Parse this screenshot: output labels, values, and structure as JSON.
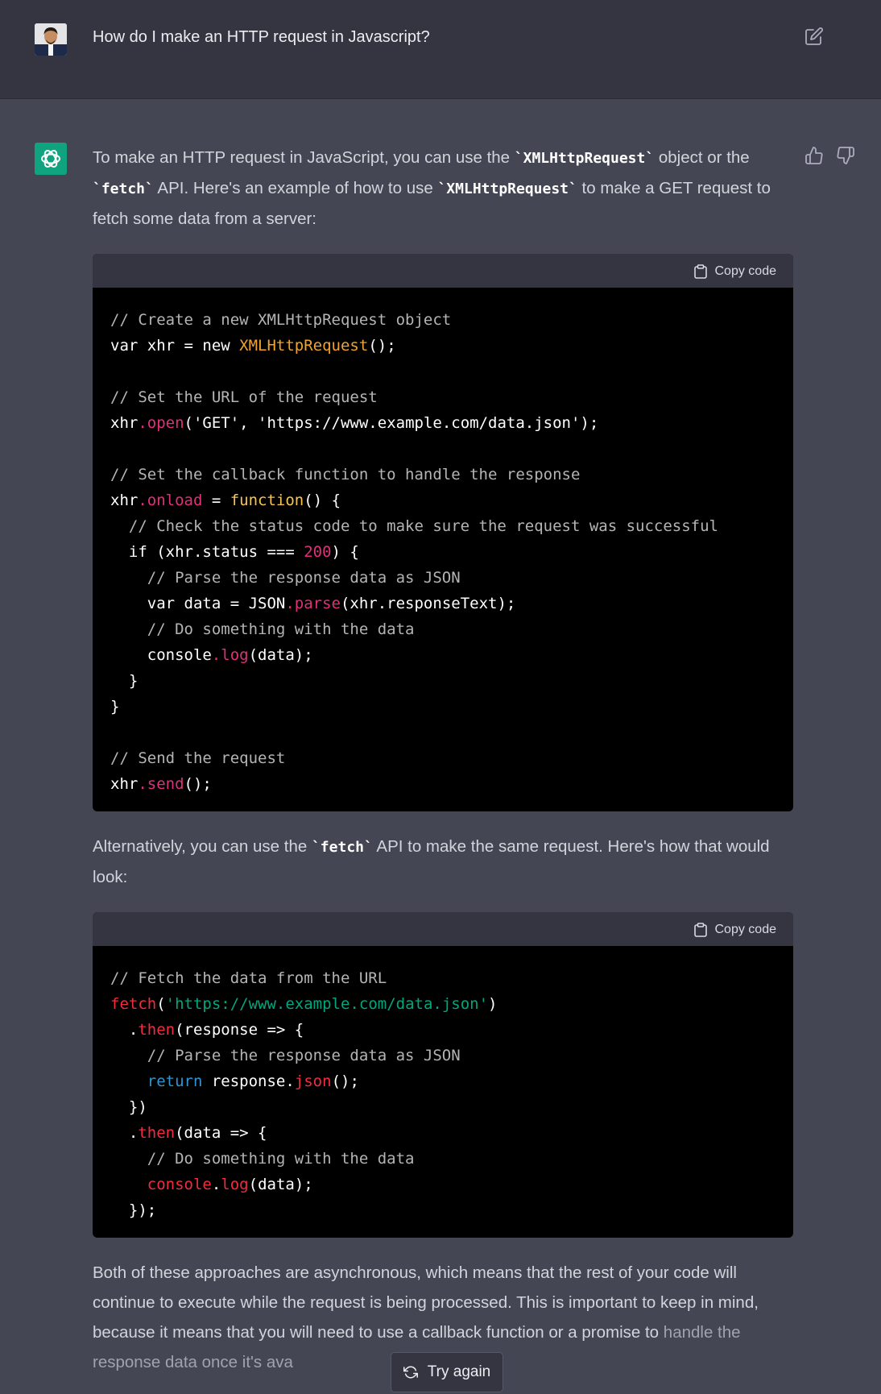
{
  "user_message": {
    "text": "How do I make an HTTP request in Javascript?"
  },
  "assistant": {
    "intro": {
      "p1": "To make an HTTP request in JavaScript, you can use the ",
      "c1": "`XMLHttpRequest`",
      "p2": " object or the ",
      "c2": "`fetch`",
      "p3": " API. Here's an example of how to use ",
      "c3": "`XMLHttpRequest`",
      "p4": " to make a GET request to fetch some data from a server:"
    },
    "copy_label": "Copy code",
    "code1": [
      "// Create a new XMLHttpRequest object",
      "var xhr = new ",
      "XMLHttpRequest",
      "();",
      "// Set the URL of the request",
      "xhr",
      ".open",
      "('GET', 'https://www.example.com/data.json');",
      "// Set the callback function to handle the response",
      "xhr",
      ".onload",
      " = ",
      "function",
      "() {",
      "  // Check the status code to make sure the request was successful",
      "  if (xhr.status === ",
      "200",
      ") {",
      "    // Parse the response data as JSON",
      "    var data = JSON",
      ".parse",
      "(xhr.responseText);",
      "    // Do something with the data",
      "    console",
      ".log",
      "(data);",
      "  }",
      "}",
      "// Send the request",
      "xhr",
      ".send",
      "();"
    ],
    "middle": {
      "p1": "Alternatively, you can use the ",
      "c1": "`fetch`",
      "p2": " API to make the same request. Here's how that would look:"
    },
    "code2": [
      "// Fetch the data from the URL",
      "fetch",
      "(",
      "'https://www.example.com/data.json'",
      ")",
      "  .",
      "then",
      "(response => {",
      "    // Parse the response data as JSON",
      "    ",
      "return",
      " response.",
      "json",
      "();",
      "  })",
      "  .",
      "then",
      "(data => {",
      "    // Do something with the data",
      "    ",
      "console",
      ".",
      "log",
      "(data);",
      "  });"
    ],
    "outro": {
      "visible": "Both of these approaches are asynchronous, which means that the rest of your code will continue to execute while the request is being processed. This is important to keep in mind, because it means that you will need to use a callback function or a promise to ",
      "faded": "handle the response data once it's ava"
    }
  },
  "try_again_label": "Try again"
}
